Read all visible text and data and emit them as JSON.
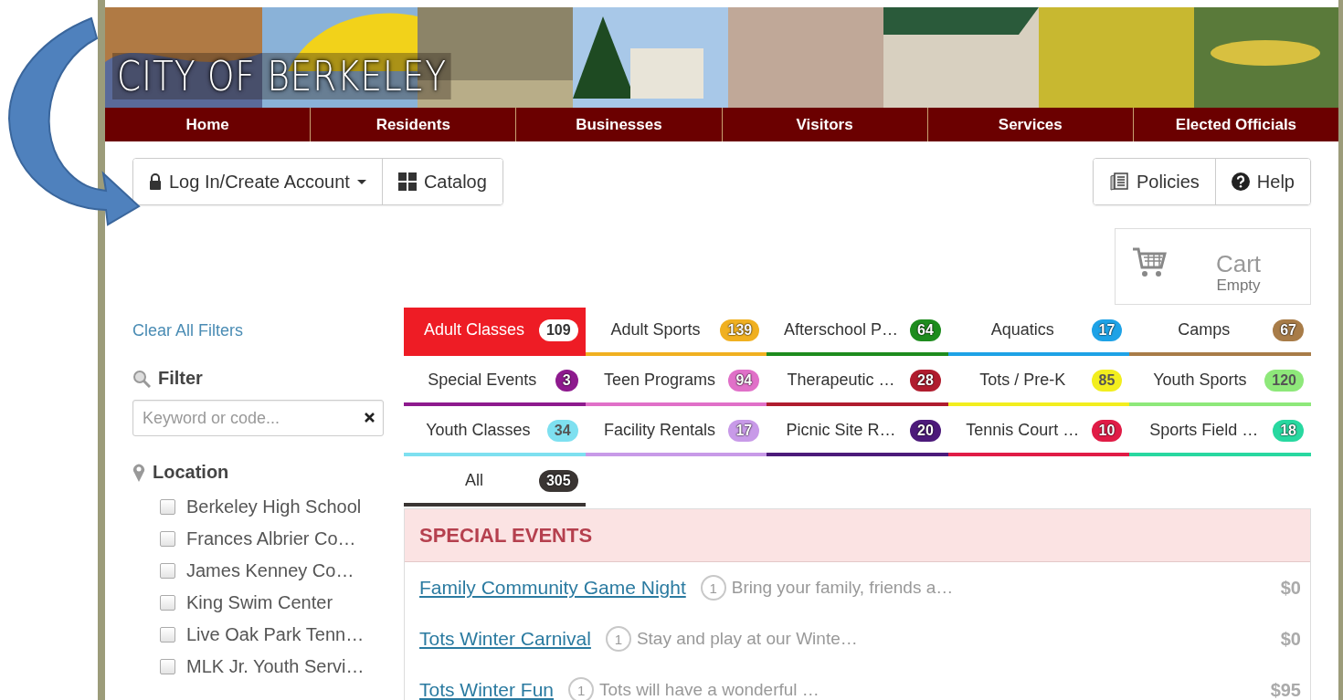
{
  "banner": {
    "title": "CITY OF BERKELEY"
  },
  "nav": [
    {
      "label": "Home"
    },
    {
      "label": "Residents"
    },
    {
      "label": "Businesses"
    },
    {
      "label": "Visitors"
    },
    {
      "label": "Services"
    },
    {
      "label": "Elected Officials"
    }
  ],
  "toolbar": {
    "left": [
      {
        "label": "Log In/Create Account",
        "dropdown": true
      },
      {
        "label": "Catalog",
        "dropdown": false
      }
    ],
    "right": [
      {
        "label": "Policies",
        "dropdown": false
      },
      {
        "label": "Help",
        "dropdown": false
      }
    ]
  },
  "cart": {
    "title": "Cart",
    "status": "Empty"
  },
  "sidebar": {
    "clear_link": "Clear All Filters",
    "filter": {
      "heading": "Filter",
      "placeholder": "Keyword or code..."
    },
    "location": {
      "heading": "Location",
      "options": [
        {
          "label": "Berkeley High School",
          "checked": false
        },
        {
          "label": "Frances Albrier Co…",
          "checked": false
        },
        {
          "label": "James Kenney Co…",
          "checked": false
        },
        {
          "label": "King Swim Center",
          "checked": false
        },
        {
          "label": "Live Oak Park Tenn…",
          "checked": false
        },
        {
          "label": "MLK Jr. Youth Servi…",
          "checked": false
        }
      ]
    }
  },
  "tabs": [
    {
      "label": "Adult Classes",
      "count": "109",
      "color": "#ee1c25",
      "selected": true
    },
    {
      "label": "Adult Sports",
      "count": "139",
      "color": "#f0b020",
      "selected": false
    },
    {
      "label": "Afterschool P…",
      "count": "64",
      "color": "#1e8c1e",
      "selected": false
    },
    {
      "label": "Aquatics",
      "count": "17",
      "color": "#1ea2e6",
      "selected": false
    },
    {
      "label": "Camps",
      "count": "67",
      "color": "#a87c48",
      "selected": false
    },
    {
      "label": "Special Events",
      "count": "3",
      "color": "#8e1a8e",
      "selected": false
    },
    {
      "label": "Teen Programs",
      "count": "94",
      "color": "#e070c8",
      "selected": false
    },
    {
      "label": "Therapeutic …",
      "count": "28",
      "color": "#b01c2e",
      "selected": false
    },
    {
      "label": "Tots / Pre-K",
      "count": "85",
      "color": "#f2ee1e",
      "selected": false
    },
    {
      "label": "Youth Sports",
      "count": "120",
      "color": "#8ee87a",
      "selected": false
    },
    {
      "label": "Youth Classes",
      "count": "34",
      "color": "#7ee0f0",
      "selected": false
    },
    {
      "label": "Facility Rentals",
      "count": "17",
      "color": "#c89ae8",
      "selected": false
    },
    {
      "label": "Picnic Site R…",
      "count": "20",
      "color": "#4c1a7a",
      "selected": false
    },
    {
      "label": "Tennis Court …",
      "count": "10",
      "color": "#e01c46",
      "selected": false
    },
    {
      "label": "Sports Field …",
      "count": "18",
      "color": "#28d8a0",
      "selected": false
    },
    {
      "label": "All",
      "count": "305",
      "color": "#3a3533",
      "selected": false
    }
  ],
  "section": {
    "title": "SPECIAL EVENTS",
    "events": [
      {
        "name": "Family Community Game Night",
        "count": "1",
        "description": "Bring your family, friends a…",
        "price": "$0"
      },
      {
        "name": "Tots Winter Carnival",
        "count": "1",
        "description": "Stay and play at our Winte…",
        "price": "$0"
      },
      {
        "name": "Tots Winter Fun",
        "count": "1",
        "description": "Tots will have a wonderful …",
        "price": "$95"
      }
    ]
  }
}
